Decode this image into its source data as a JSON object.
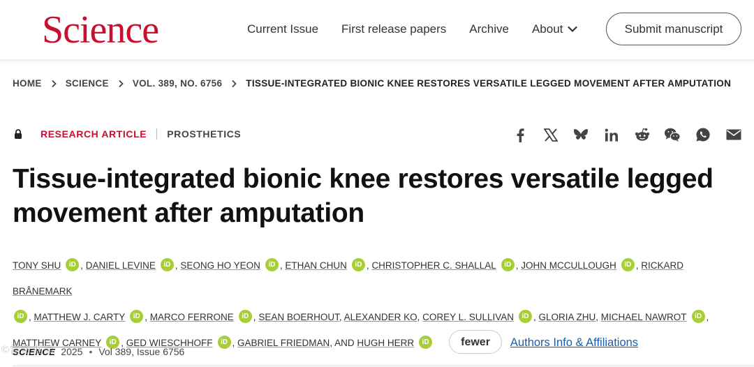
{
  "header": {
    "logo_text": "Science",
    "logo_color": "#c8102e",
    "nav": [
      {
        "label": "Current Issue"
      },
      {
        "label": "First release papers"
      },
      {
        "label": "Archive"
      },
      {
        "label": "About"
      }
    ],
    "submit_label": "Submit manuscript"
  },
  "breadcrumb": {
    "items": [
      "HOME",
      "SCIENCE",
      "VOL. 389, NO. 6756"
    ],
    "current": "TISSUE-INTEGRATED BIONIC KNEE RESTORES VERSATILE LEGGED MOVEMENT AFTER AMPUTATION"
  },
  "article": {
    "type": "RESEARCH ARTICLE",
    "subject": "PROSTHETICS",
    "title": "Tissue-integrated bionic knee restores versatile legged movement after amputation",
    "authors": [
      "TONY SHU",
      "DANIEL LEVINE",
      "SEONG HO YEON",
      "ETHAN CHUN",
      "CHRISTOPHER C. SHALLAL",
      "JOHN MCCULLOUGH",
      "RICKARD BRÅNEMARK",
      "MATTHEW J. CARTY",
      "MARCO FERRONE",
      "SEAN BOERHOUT",
      "ALEXANDER KO",
      "COREY L. SULLIVAN",
      "GLORIA ZHU",
      "MICHAEL NAWROT",
      "MATTHEW CARNEY",
      "GED WIESCHHOFF",
      "GABRIEL FRIEDMAN",
      "HUGH HERR"
    ],
    "orcid_label": "iD",
    "and_text": "AND",
    "fewer_label": "fewer",
    "affiliations_link": "Authors Info & Affiliations",
    "journal": "SCIENCE",
    "date": "2025",
    "volume": "Vol 389, Issue 6756"
  },
  "share_icons": [
    "facebook-icon",
    "x-icon",
    "bluesky-icon",
    "linkedin-icon",
    "reddit-icon",
    "wechat-icon",
    "whatsapp-icon",
    "email-icon"
  ],
  "watermark": "©雷数据库",
  "colors": {
    "accent": "#c8102e",
    "link": "#1a5cad",
    "orcid": "#a6ce39"
  }
}
